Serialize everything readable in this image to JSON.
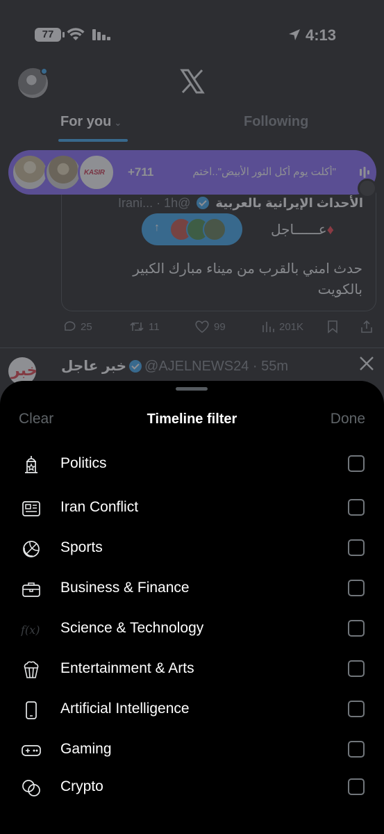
{
  "status_bar": {
    "battery": "77",
    "time": "4:13"
  },
  "header": {
    "logo": "X",
    "tabs": [
      {
        "label": "For you"
      },
      {
        "label": "Following"
      }
    ]
  },
  "spaces_bar": {
    "count": "+711",
    "title": "\"أكلت يوم أكل الثور الأبيض\"..اختم",
    "badge_text": "KASIR"
  },
  "quoted_tweet": {
    "author_name": "الأحداث الإيرانية بالعربية",
    "handle": "@Irani... · 1h",
    "urgent_label": "عــــــاجل",
    "body": "حدث امني بالقرب من  ميناء مبارك الكبير بالكويت"
  },
  "tweet_actions": {
    "replies": "25",
    "reposts": "11",
    "likes": "99",
    "views": "201K"
  },
  "second_tweet": {
    "author_name": "خبر عاجل",
    "handle": "@AJELNEWS24 · 55m",
    "avatar_text": "خبر"
  },
  "sheet": {
    "clear_label": "Clear",
    "title": "Timeline filter",
    "done_label": "Done",
    "items": [
      {
        "label": "Politics",
        "icon": "politics-icon",
        "checked": false
      },
      {
        "label": "Iran Conflict",
        "icon": "news-icon",
        "checked": false
      },
      {
        "label": "Sports",
        "icon": "sports-ball-icon",
        "checked": false
      },
      {
        "label": "Business & Finance",
        "icon": "briefcase-icon",
        "checked": false
      },
      {
        "label": "Science & Technology",
        "icon": "function-icon",
        "checked": false
      },
      {
        "label": "Entertainment & Arts",
        "icon": "popcorn-icon",
        "checked": false
      },
      {
        "label": "Artificial Intelligence",
        "icon": "phone-icon",
        "checked": false
      },
      {
        "label": "Gaming",
        "icon": "gamepad-icon",
        "checked": false
      },
      {
        "label": "Crypto",
        "icon": "coins-icon",
        "checked": false
      }
    ]
  },
  "colors": {
    "accent": "#1d9bf0",
    "spaces": "#7856ff",
    "muted": "#71767b"
  }
}
